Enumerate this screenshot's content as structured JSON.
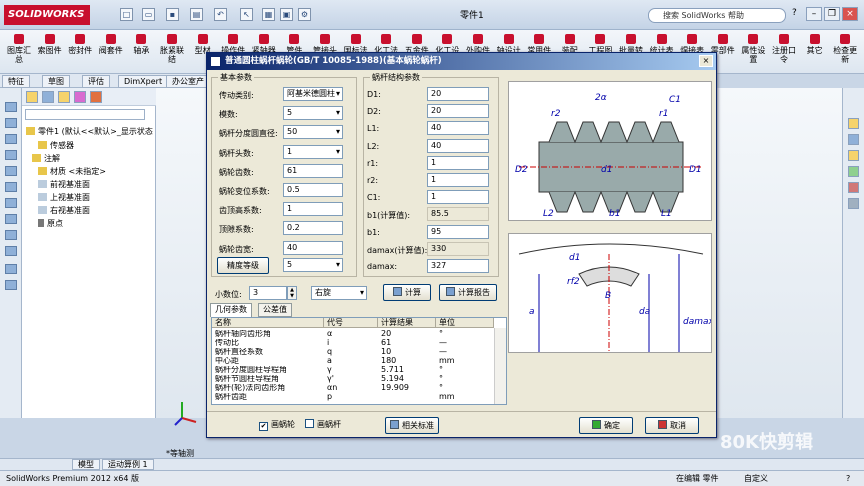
{
  "app": {
    "logo": "SOLIDWORKS",
    "doc_title": "零件1",
    "help_search": "搜索 SolidWorks 帮助",
    "help_q": "?"
  },
  "ribbon": [
    "图库汇总",
    "索图件",
    "密封件",
    "阀套件",
    "轴承",
    "胀紧联结",
    "型材",
    "操作件",
    "紧轴器",
    "管件",
    "管接头",
    "国标法",
    "化工法",
    "五金件",
    "化工设",
    "外购件",
    "轴设计",
    "常用件",
    "装配",
    "工程图",
    "批量转",
    "统计表",
    "焊接表",
    "零部件",
    "属性设置",
    "注册口令",
    "其它",
    "检查更新"
  ],
  "feature_tabs": [
    "特征",
    "草图",
    "评估",
    "DimXpert",
    "办公室产品"
  ],
  "tree": {
    "root": "零件1 (默认<<默认>_显示状态",
    "items": [
      "传感器",
      "注解",
      "材质 <未指定>",
      "前视基准面",
      "上视基准面",
      "右视基准面",
      "原点"
    ]
  },
  "dialog": {
    "title": "普通圆柱蜗杆蜗轮(GB/T 10085-1988)(基本蜗轮蜗杆)",
    "basic_group": "基本参数",
    "basic": [
      {
        "label": "传动类别:",
        "value": "阿基米德圆柱"
      },
      {
        "label": "模数:",
        "value": "5"
      },
      {
        "label": "蜗杆分度圆直径:",
        "value": "50"
      },
      {
        "label": "蜗杆头数:",
        "value": "1"
      },
      {
        "label": "蜗轮齿数:",
        "value": "61"
      },
      {
        "label": "蜗轮变位系数:",
        "value": "0.5"
      },
      {
        "label": "齿顶高系数:",
        "value": "1"
      },
      {
        "label": "顶隙系数:",
        "value": "0.2"
      },
      {
        "label": "蜗轮齿宽:",
        "value": "40"
      }
    ],
    "precision_btn": "精度等级",
    "precision_value": "5",
    "struct_group": "蜗杆结构参数",
    "struct": [
      {
        "label": "D1:",
        "value": "20"
      },
      {
        "label": "D2:",
        "value": "20"
      },
      {
        "label": "L1:",
        "value": "40"
      },
      {
        "label": "L2:",
        "value": "40"
      },
      {
        "label": "r1:",
        "value": "1"
      },
      {
        "label": "r2:",
        "value": "1"
      },
      {
        "label": "C1:",
        "value": "1"
      },
      {
        "label": "b1(计算值):",
        "value": "85.5"
      },
      {
        "label": "b1:",
        "value": "95"
      },
      {
        "label": "damax(计算值):",
        "value": "330"
      },
      {
        "label": "damax:",
        "value": "327"
      }
    ],
    "decimals_label": "小数位:",
    "decimals_value": "3",
    "hand_value": "右旋",
    "calc_btn": "计算",
    "report_btn": "计算报告",
    "tab_geom": "几何参数",
    "tab_tol": "公差值",
    "columns": [
      "名称",
      "代号",
      "计算结果",
      "单位"
    ],
    "rows": [
      [
        "蜗杆轴向齿形角",
        "α",
        "20",
        "°"
      ],
      [
        "传动比",
        "i",
        "61",
        "—"
      ],
      [
        "蜗杆直径系数",
        "q",
        "10",
        "—"
      ],
      [
        "中心距",
        "a",
        "180",
        "mm"
      ],
      [
        "蜗杆分度圆柱导程角",
        "γ",
        "5.711",
        "°"
      ],
      [
        "蜗杆节圆柱导程角",
        "γ'",
        "5.194",
        "°"
      ],
      [
        "蜗杆(轮)法向齿形角",
        "αn",
        "19.909",
        "°"
      ],
      [
        "蜗杆齿距",
        "p",
        "",
        "mm"
      ]
    ],
    "draw_wheel": "画蜗轮",
    "draw_worm": "画蜗杆",
    "std_btn": "相关标准",
    "ok_btn": "确定",
    "cancel_btn": "取消",
    "fig1_labels": [
      "2α",
      "r2",
      "r1",
      "C1",
      "D2",
      "d1",
      "D1",
      "L2",
      "b1",
      "L1"
    ],
    "fig2_labels": [
      "d1",
      "rf2",
      "B",
      "a",
      "da",
      "damax"
    ]
  },
  "view_label": "*等轴测",
  "bottom_tabs": [
    "模型",
    "运动算例 1"
  ],
  "status": {
    "left": "SolidWorks Premium 2012 x64 版",
    "mode": "在编辑 零件",
    "custom": "自定义",
    "help": "?"
  },
  "watermark": "80K快剪辑"
}
